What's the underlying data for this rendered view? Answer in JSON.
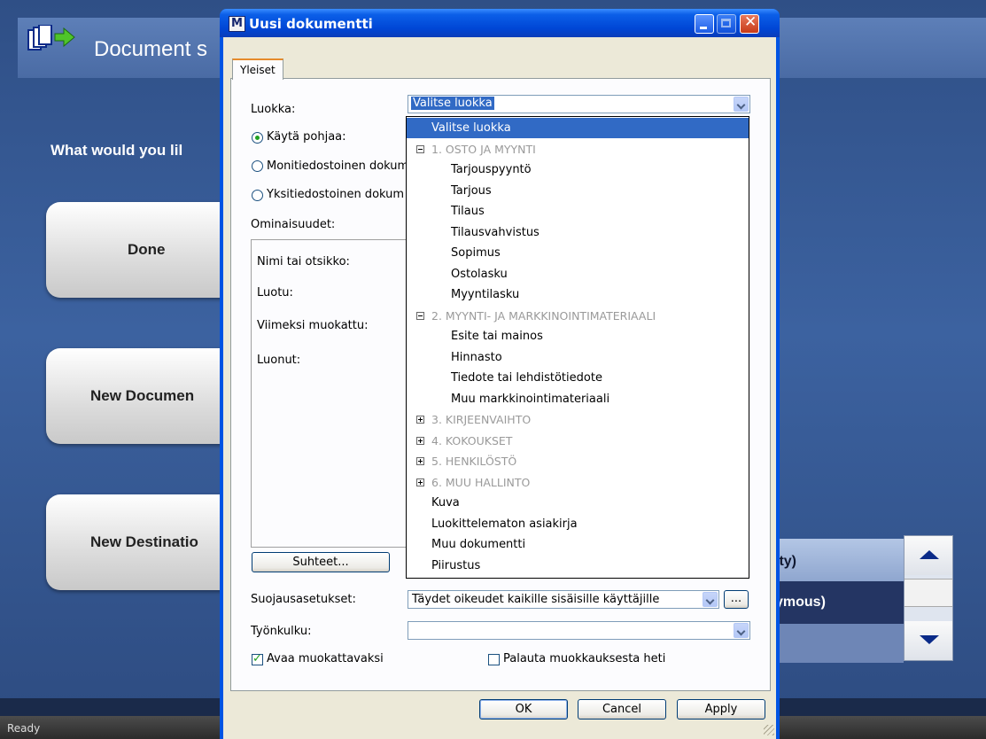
{
  "background_app": {
    "title": "Document s",
    "question": "What would you lil",
    "buttons": [
      "Done",
      "New Documen",
      "New Destinatio"
    ],
    "list_rows": [
      "ity)",
      "ymous)"
    ],
    "status": "Ready"
  },
  "dialog": {
    "title": "Uusi dokumentti",
    "app_icon_letter": "M",
    "tab": "Yleiset",
    "luokka_label": "Luokka:",
    "luokka_value": "Valitse luokka",
    "radio_template": "Käytä pohjaa:",
    "radio_multi": "Monitiedostoinen dokum",
    "radio_single": "Yksitiedostoinen dokum",
    "properties_label": "Ominaisuudet:",
    "prop_name": "Nimi tai otsikko:",
    "prop_created": "Luotu:",
    "prop_modified": "Viimeksi muokattu:",
    "prop_author": "Luonut:",
    "relations_button": "Suhteet...",
    "security_label": "Suojausasetukset:",
    "security_value": "Täydet oikeudet kaikille sisäisille käyttäjille",
    "ellipsis_button": "...",
    "workflow_label": "Työnkulku:",
    "workflow_value": "",
    "open_edit_label": "Avaa muokattavaksi",
    "revert_label": "Palauta muokkauksesta heti",
    "ok_button": "OK",
    "cancel_button": "Cancel",
    "apply_button": "Apply"
  },
  "dropdown": {
    "items": [
      {
        "label": "Valitse luokka",
        "kind": "selected"
      },
      {
        "label": "1. OSTO JA MYYNTI",
        "kind": "cat-open"
      },
      {
        "label": "Tarjouspyyntö",
        "kind": "child"
      },
      {
        "label": "Tarjous",
        "kind": "child"
      },
      {
        "label": "Tilaus",
        "kind": "child"
      },
      {
        "label": "Tilausvahvistus",
        "kind": "child"
      },
      {
        "label": "Sopimus",
        "kind": "child"
      },
      {
        "label": "Ostolasku",
        "kind": "child"
      },
      {
        "label": "Myyntilasku",
        "kind": "child"
      },
      {
        "label": "2. MYYNTI- JA MARKKINOINTIMATERIAALI",
        "kind": "cat-open"
      },
      {
        "label": "Esite tai mainos",
        "kind": "child"
      },
      {
        "label": "Hinnasto",
        "kind": "child"
      },
      {
        "label": "Tiedote tai lehdistötiedote",
        "kind": "child"
      },
      {
        "label": "Muu markkinointimateriaali",
        "kind": "child"
      },
      {
        "label": "3. KIRJEENVAIHTO",
        "kind": "cat-closed"
      },
      {
        "label": "4. KOKOUKSET",
        "kind": "cat-closed"
      },
      {
        "label": "5. HENKILÖSTÖ",
        "kind": "cat-closed"
      },
      {
        "label": "6. MUU HALLINTO",
        "kind": "cat-closed"
      },
      {
        "label": "Kuva",
        "kind": "top"
      },
      {
        "label": "Luokittelematon asiakirja",
        "kind": "top"
      },
      {
        "label": "Muu dokumentti",
        "kind": "top"
      },
      {
        "label": "Piirustus",
        "kind": "top"
      }
    ]
  },
  "colors": {
    "selection": "#316ac5",
    "titlebar": "#0054e3",
    "dialog_face": "#ece9d8",
    "category_text": "#9a9a9a"
  }
}
